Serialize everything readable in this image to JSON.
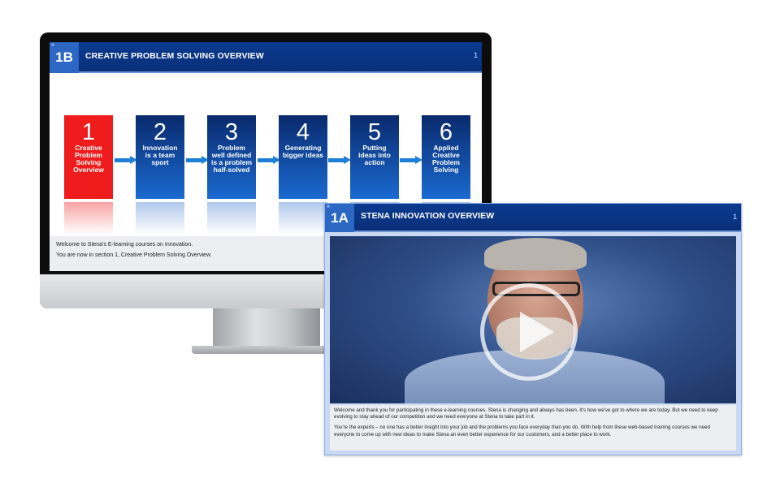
{
  "monitor_course": {
    "section_code": "1B",
    "title": "CREATIVE PROBLEM SOLVING OVERVIEW",
    "page": "1",
    "steps": [
      {
        "num": "1",
        "label": "Creative Problem Solving Overview"
      },
      {
        "num": "2",
        "label": "Innovation is a team sport"
      },
      {
        "num": "3",
        "label": "Problem well defined is a problem half-solved"
      },
      {
        "num": "4",
        "label": "Generating bigger ideas"
      },
      {
        "num": "5",
        "label": "Putting ideas into action"
      },
      {
        "num": "6",
        "label": "Applied Creative Problem Solving"
      }
    ],
    "active_step": 1,
    "text_lines": [
      "Welcome to Stena's E-learning courses on Innovation.",
      "You are now in section 1, Creative Problem Solving Overview."
    ]
  },
  "panel_course": {
    "section_code": "1A",
    "title": "STENA INNOVATION OVERVIEW",
    "page": "1",
    "paragraphs": [
      "Welcome and thank you for participating in these e-learning courses. Stena is changing and always has been. It's how we've got to where we are today. But we need to keep evolving to stay ahead of our competition and we need everyone at Stena to take part in it.",
      "You're the experts – no one has a better insight into your job and the problems you face everyday than you do. With help from these web-based training courses we need everyone to come up with new ideas to make Stena an even better experience for our customers, and a better place to work."
    ]
  },
  "icons": {
    "expand": "expand-icon",
    "play": "play-icon"
  },
  "colors": {
    "header_blue": "#0a3a8f",
    "section_code_blue": "#2c67c4",
    "active_step_red": "#ee1c1c",
    "arrow_blue": "#1d7fd6"
  }
}
